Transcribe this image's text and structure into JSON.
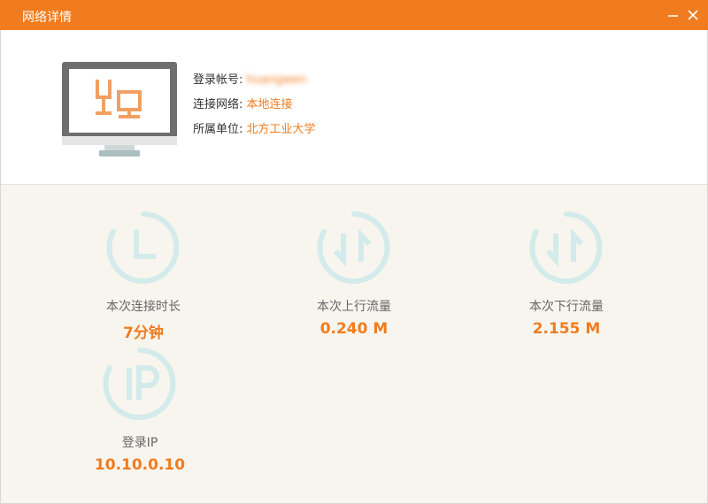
{
  "window": {
    "title": "网络详情"
  },
  "account": {
    "account_label": "登录帐号:",
    "account_value": "huangwen",
    "network_label": "连接网络:",
    "network_value": "本地连接",
    "unit_label": "所属单位:",
    "unit_value": "北方工业大学"
  },
  "stats": {
    "duration_label": "本次连接时长",
    "duration_value": "7分钟",
    "upload_label": "本次上行流量",
    "upload_value": "0.240 M",
    "download_label": "本次下行流量",
    "download_value": "2.155 M",
    "ip_label": "登录IP",
    "ip_value": "10.10.0.10"
  },
  "colors": {
    "accent": "#f07c1f",
    "icon_ring": "#d3ebea"
  },
  "icons": [
    "minimize-icon",
    "close-icon",
    "monitor-icon",
    "clock-icon",
    "upload-arrows-icon",
    "download-arrows-icon",
    "ip-icon"
  ]
}
